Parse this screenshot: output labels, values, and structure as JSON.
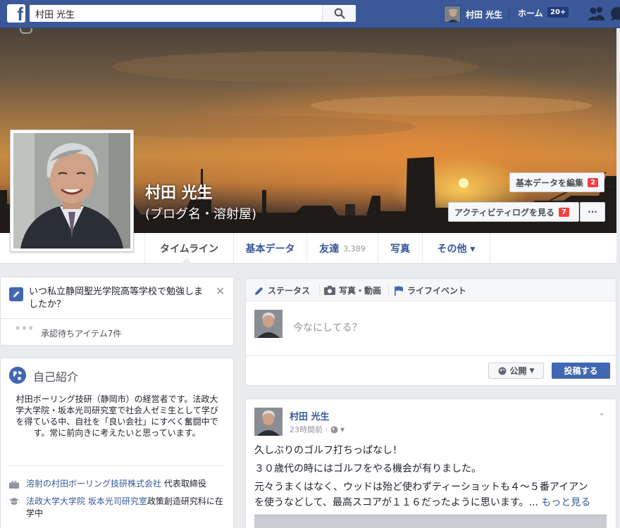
{
  "topbar": {
    "logo": "f",
    "search_value": "村田 光生",
    "user_name": "村田 光生",
    "home_label": "ホーム",
    "home_badge": "20+"
  },
  "profile": {
    "name": "村田 光生",
    "subtitle": "(ブログ名・溶射屋)",
    "edit_button": "基本データを編集",
    "edit_badge": "2",
    "activity_button": "アクティビティログを見る",
    "activity_badge": "7",
    "more_button": "···"
  },
  "tabs": [
    {
      "label": "タイムライン",
      "count": ""
    },
    {
      "label": "基本データ",
      "count": ""
    },
    {
      "label": "友達",
      "count": "3,389"
    },
    {
      "label": "写真",
      "count": ""
    },
    {
      "label": "その他 ▾",
      "count": ""
    }
  ],
  "question_card": {
    "question": "いつ私立静岡聖光学院高等学校で勉強しましたか？",
    "close": "✕",
    "pending_dots": "•••",
    "pending_label": "承認待ちアイテム7件"
  },
  "intro": {
    "title": "自己紹介",
    "description": "村田ボーリング技研（静岡市）の経営者です。法政大学大学院・坂本光司研究室で社会人ゼミ生として学びを得ている中、自社を「良い会社」にすべく奮闘中です。常に前向きに考えたいと思っています。",
    "work_link": "溶射の村田ボーリング技研株式会社",
    "work_role": " 代表取締役",
    "edu_link": "法政大学大学院 坂本光司研究室",
    "edu_rest": "政策創造研究科に在学中"
  },
  "composer": {
    "tab_status": "ステータス",
    "tab_photo": "写真・動画",
    "tab_life": "ライフイベント",
    "placeholder": "今なにしてる？",
    "privacy": "公開",
    "post_button": "投稿する"
  },
  "post": {
    "author": "村田 光生",
    "time": "23時間前 ·",
    "line1": "久しぶりのゴルフ打ちっぱなし！",
    "line2": "３０歳代の時にはゴルフをやる機会が有りました。",
    "line3": "元々うまくはなく、ウッドは殆ど使わずティーショットも４～５番アイアン",
    "line4": "を使うなどして、最高スコアが１１６だったように思います。...",
    "more_link": "もっと見る"
  },
  "colors": {
    "fb_blue": "#3b5998",
    "link_blue": "#365899",
    "badge_red": "#fa3e3e"
  }
}
